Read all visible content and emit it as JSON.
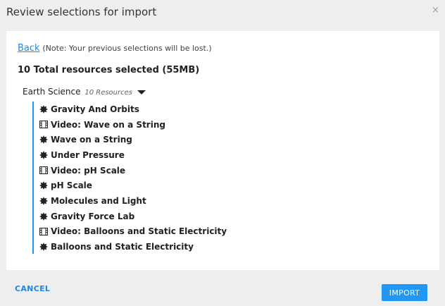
{
  "dialog": {
    "title": "Review selections for import",
    "close_label": "×"
  },
  "back": {
    "link_label": "Back",
    "note": "(Note: Your previous selections will be lost.)"
  },
  "summary": "10 Total resources selected (55MB)",
  "topic": {
    "name": "Earth Science",
    "count_label": "10 Resources",
    "resources": [
      {
        "title": "Gravity And Orbits",
        "icon": "exercise-icon"
      },
      {
        "title": "Video: Wave on a String",
        "icon": "video-icon"
      },
      {
        "title": "Wave on a String",
        "icon": "exercise-icon"
      },
      {
        "title": "Under Pressure",
        "icon": "exercise-icon"
      },
      {
        "title": "Video: pH Scale",
        "icon": "video-icon"
      },
      {
        "title": "pH Scale",
        "icon": "exercise-icon"
      },
      {
        "title": "Molecules and Light",
        "icon": "exercise-icon"
      },
      {
        "title": "Gravity Force Lab",
        "icon": "exercise-icon"
      },
      {
        "title": "Video: Balloons and Static Electricity",
        "icon": "video-icon"
      },
      {
        "title": "Balloons and Static Electricity",
        "icon": "exercise-icon"
      }
    ]
  },
  "footer": {
    "cancel_label": "CANCEL",
    "import_label": "IMPORT"
  },
  "colors": {
    "accent": "#2196f3",
    "link": "#1e88e5",
    "background": "#eeeeee"
  }
}
